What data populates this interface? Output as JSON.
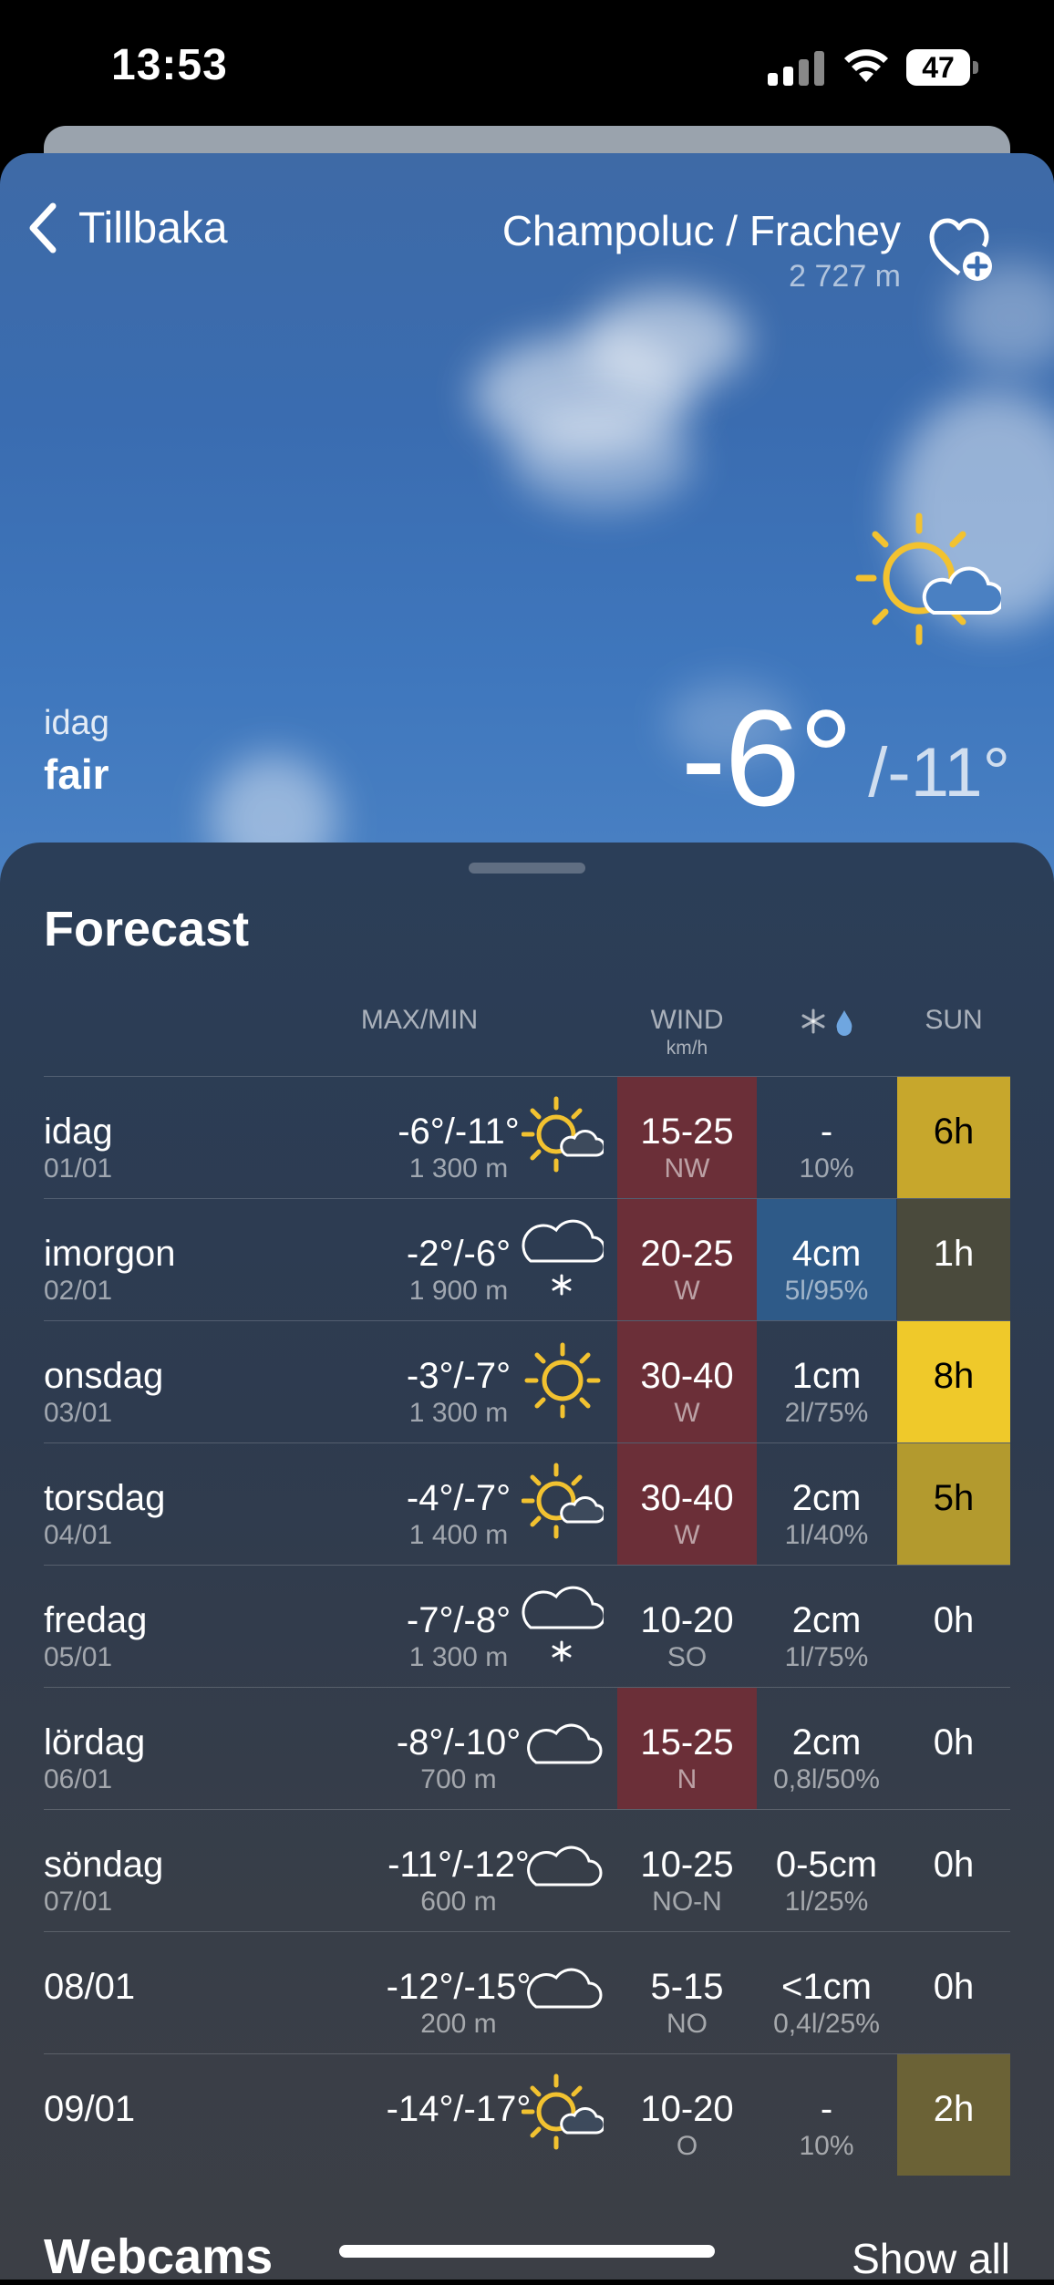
{
  "status": {
    "time": "13:53",
    "battery": "47"
  },
  "header": {
    "back_label": "Tillbaka",
    "location": "Champoluc / Frachey",
    "altitude": "2 727 m"
  },
  "current": {
    "day_label": "idag",
    "condition": "fair",
    "temp": "-6°",
    "min": "/-11°",
    "icon": "sun-cloud-icon"
  },
  "forecast": {
    "title": "Forecast",
    "headers": {
      "maxmin": "MAX/MIN",
      "wind": "WIND",
      "wind_unit": "km/h",
      "sun": "SUN"
    },
    "rows": [
      {
        "day": "idag",
        "date": "01/01",
        "temp": "-6°/-11°",
        "alt": "1 300 m",
        "icon": "sun-cloud",
        "wind": "15-25",
        "dir": "NW",
        "wind_color": "#6b2f38",
        "precip": "-",
        "prob": "10%",
        "precip_color": "",
        "sun": "6h",
        "sun_color": "#c7a72c",
        "sun_text": "#000000"
      },
      {
        "day": "imorgon",
        "date": "02/01",
        "temp": "-2°/-6°",
        "alt": "1 900 m",
        "icon": "snow-cloud",
        "wind": "20-25",
        "dir": "W",
        "wind_color": "#6b2f38",
        "precip": "4cm",
        "prob": "5l/95%",
        "precip_color": "#2e5a88",
        "sun": "1h",
        "sun_color": "#4a4a3c",
        "sun_text": "#ffffff"
      },
      {
        "day": "onsdag",
        "date": "03/01",
        "temp": "-3°/-7°",
        "alt": "1 300 m",
        "icon": "sun",
        "wind": "30-40",
        "dir": "W",
        "wind_color": "#6b2f38",
        "precip": "1cm",
        "prob": "2l/75%",
        "precip_color": "",
        "sun": "8h",
        "sun_color": "#efc92a",
        "sun_text": "#000000"
      },
      {
        "day": "torsdag",
        "date": "04/01",
        "temp": "-4°/-7°",
        "alt": "1 400 m",
        "icon": "sun-cloud",
        "wind": "30-40",
        "dir": "W",
        "wind_color": "#6b2f38",
        "precip": "2cm",
        "prob": "1l/40%",
        "precip_color": "",
        "sun": "5h",
        "sun_color": "#b39a2e",
        "sun_text": "#000000"
      },
      {
        "day": "fredag",
        "date": "05/01",
        "temp": "-7°/-8°",
        "alt": "1 300 m",
        "icon": "snow-cloud",
        "wind": "10-20",
        "dir": "SO",
        "wind_color": "",
        "precip": "2cm",
        "prob": "1l/75%",
        "precip_color": "",
        "sun": "0h",
        "sun_color": "",
        "sun_text": "#ffffff"
      },
      {
        "day": "lördag",
        "date": "06/01",
        "temp": "-8°/-10°",
        "alt": "700 m",
        "icon": "cloud",
        "wind": "15-25",
        "dir": "N",
        "wind_color": "#6b2f38",
        "precip": "2cm",
        "prob": "0,8l/50%",
        "precip_color": "",
        "sun": "0h",
        "sun_color": "",
        "sun_text": "#ffffff"
      },
      {
        "day": "söndag",
        "date": "07/01",
        "temp": "-11°/-12°",
        "alt": "600 m",
        "icon": "cloud",
        "wind": "10-25",
        "dir": "NO-N",
        "wind_color": "",
        "precip": "0-5cm",
        "prob": "1l/25%",
        "precip_color": "",
        "sun": "0h",
        "sun_color": "",
        "sun_text": "#ffffff"
      },
      {
        "day": "08/01",
        "date": "",
        "temp": "-12°/-15°",
        "alt": "200 m",
        "icon": "cloud",
        "wind": "5-15",
        "dir": "NO",
        "wind_color": "",
        "precip": "<1cm",
        "prob": "0,4l/25%",
        "precip_color": "",
        "sun": "0h",
        "sun_color": "",
        "sun_text": "#ffffff"
      },
      {
        "day": "09/01",
        "date": "",
        "temp": "-14°/-17°",
        "alt": "",
        "icon": "sun-cloud",
        "wind": "10-20",
        "dir": "O",
        "wind_color": "",
        "precip": "-",
        "prob": "10%",
        "precip_color": "",
        "sun": "2h",
        "sun_color": "#6b6236",
        "sun_text": "#ffffff"
      }
    ]
  },
  "webcams": {
    "title": "Webcams",
    "show_all": "Show all"
  }
}
